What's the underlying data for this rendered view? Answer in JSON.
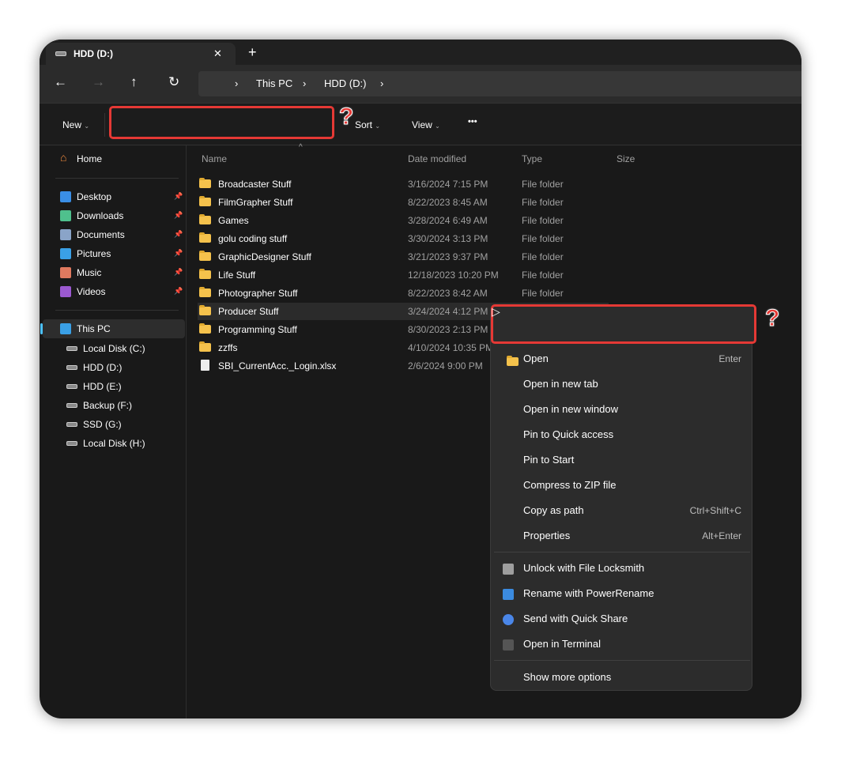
{
  "tab": {
    "title": "HDD (D:)",
    "close": "✕",
    "new_tab": "+"
  },
  "nav": {
    "back": "←",
    "forward": "→",
    "up": "↑",
    "refresh": "↻",
    "breadcrumb": [
      "This PC",
      "HDD (D:)"
    ]
  },
  "toolbar": {
    "new": "New",
    "sort": "Sort",
    "view": "View",
    "more": "•••"
  },
  "sidebar": {
    "home": "Home",
    "quick": [
      {
        "label": "Desktop",
        "icon": "desktop-icon",
        "color": "#3a8ee6"
      },
      {
        "label": "Downloads",
        "icon": "download-icon",
        "color": "#4fc08d"
      },
      {
        "label": "Documents",
        "icon": "documents-icon",
        "color": "#8aa4c8"
      },
      {
        "label": "Pictures",
        "icon": "pictures-icon",
        "color": "#3aa0e6"
      },
      {
        "label": "Music",
        "icon": "music-icon",
        "color": "#e07a5f"
      },
      {
        "label": "Videos",
        "icon": "videos-icon",
        "color": "#9b59d0"
      }
    ],
    "this_pc": "This PC",
    "drives": [
      "Local Disk (C:)",
      "HDD (D:)",
      "HDD (E:)",
      "Backup (F:)",
      "SSD (G:)",
      "Local Disk (H:)"
    ]
  },
  "columns": {
    "name": "Name",
    "date": "Date modified",
    "type": "Type",
    "size": "Size"
  },
  "files": [
    {
      "name": "Broadcaster Stuff",
      "date": "3/16/2024 7:15 PM",
      "type": "File folder"
    },
    {
      "name": "FilmGrapher Stuff",
      "date": "8/22/2023 8:45 AM",
      "type": "File folder"
    },
    {
      "name": "Games",
      "date": "3/28/2024 6:49 AM",
      "type": "File folder"
    },
    {
      "name": "golu coding stuff",
      "date": "3/30/2024 3:13 PM",
      "type": "File folder"
    },
    {
      "name": "GraphicDesigner Stuff",
      "date": "3/21/2023 9:37 PM",
      "type": "File folder"
    },
    {
      "name": "Life Stuff",
      "date": "12/18/2023 10:20 PM",
      "type": "File folder"
    },
    {
      "name": "Photographer Stuff",
      "date": "8/22/2023 8:42 AM",
      "type": "File folder"
    },
    {
      "name": "Producer Stuff",
      "date": "3/24/2024 4:12 PM",
      "type": ""
    },
    {
      "name": "Programming Stuff",
      "date": "8/30/2023 2:13 PM",
      "type": ""
    },
    {
      "name": "zzffs",
      "date": "4/10/2024 10:35 PM",
      "type": ""
    },
    {
      "name": "SBI_CurrentAcc._Login.xlsx",
      "date": "2/6/2024 9:00 PM",
      "type": "",
      "file": true
    }
  ],
  "context_menu": {
    "group1": [
      {
        "label": "Open",
        "shortcut": "Enter"
      },
      {
        "label": "Open in new tab",
        "shortcut": ""
      },
      {
        "label": "Open in new window",
        "shortcut": ""
      },
      {
        "label": "Pin to Quick access",
        "shortcut": ""
      },
      {
        "label": "Pin to Start",
        "shortcut": ""
      },
      {
        "label": "Compress to ZIP file",
        "shortcut": ""
      },
      {
        "label": "Copy as path",
        "shortcut": "Ctrl+Shift+C"
      },
      {
        "label": "Properties",
        "shortcut": "Alt+Enter"
      }
    ],
    "group2": [
      {
        "label": "Unlock with File Locksmith",
        "icon": "lock-icon",
        "color": "#9e9e9e"
      },
      {
        "label": "Rename with PowerRename",
        "icon": "rename-icon",
        "color": "#3b8be0"
      },
      {
        "label": "Send with Quick Share",
        "icon": "quick-share-icon",
        "color": "#4a86e8"
      },
      {
        "label": "Open in Terminal",
        "icon": "terminal-icon",
        "color": "#555"
      }
    ],
    "show_more": "Show more options"
  },
  "annotation": {
    "mark": "?",
    "color": "#e53935"
  }
}
